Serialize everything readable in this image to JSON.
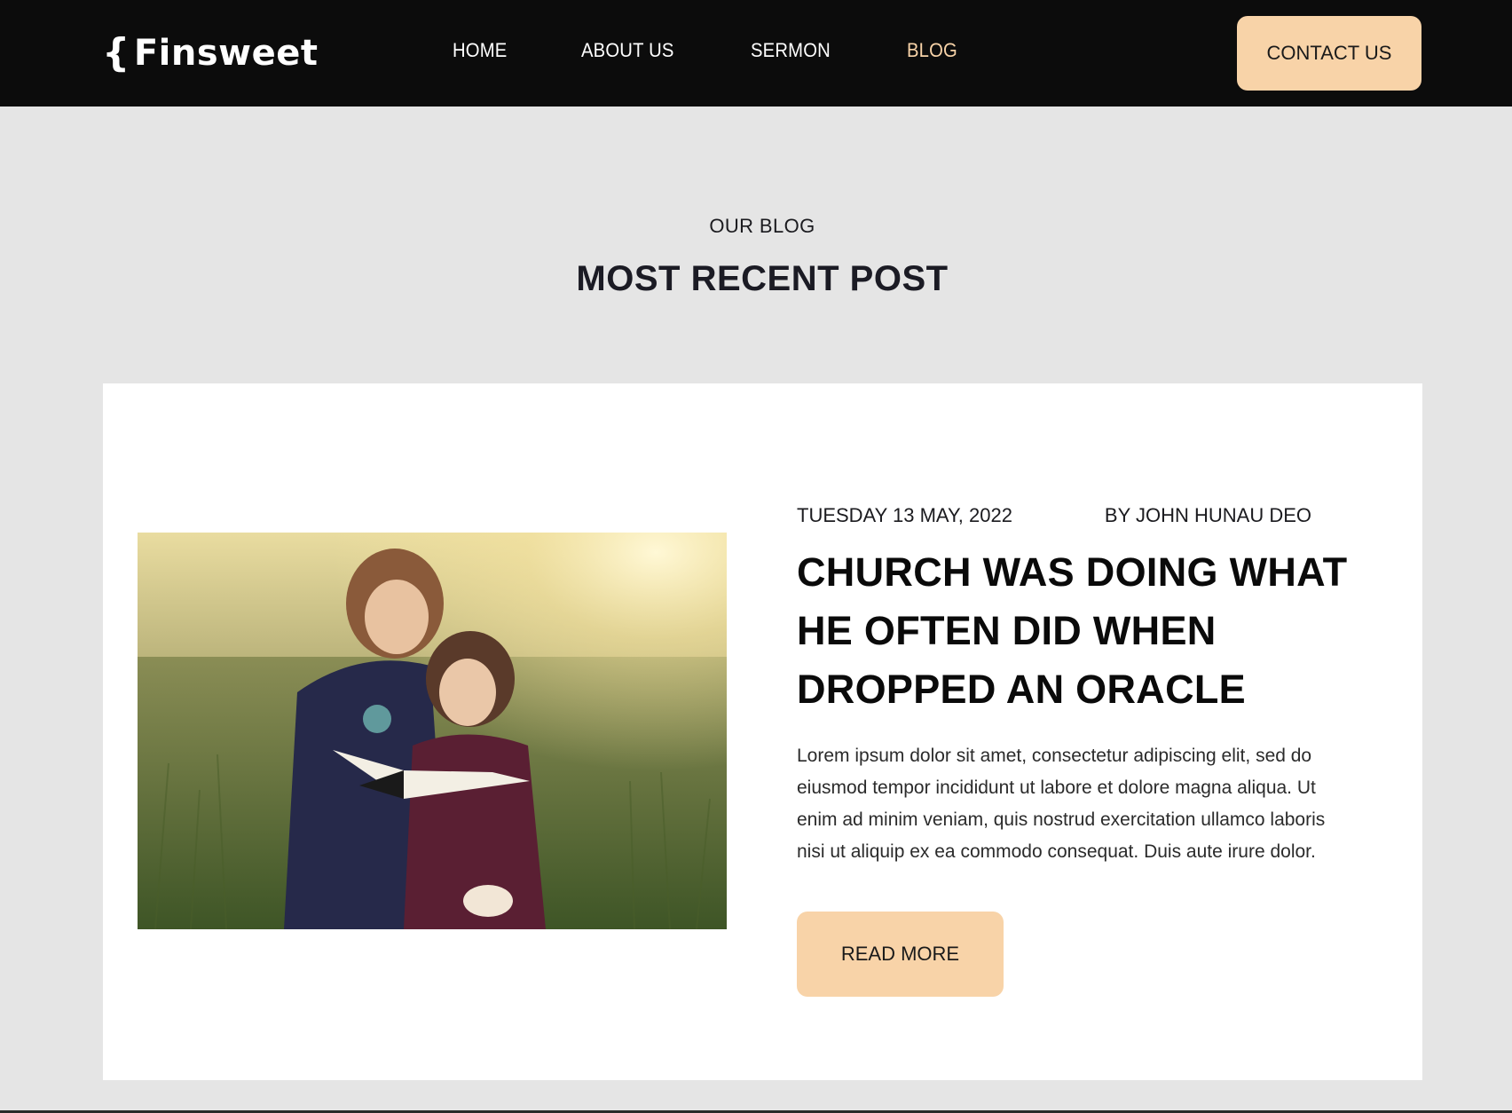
{
  "nav": {
    "logo_brace": "{",
    "logo_text": "Finsweet",
    "links": [
      {
        "label": "HOME"
      },
      {
        "label": "ABOUT US"
      },
      {
        "label": "SERMON"
      },
      {
        "label": "BLOG"
      }
    ],
    "active_link": "BLOG",
    "contact_label": "CONTACT US"
  },
  "section": {
    "eyebrow": "OUR BLOG",
    "title": "MOST RECENT POST"
  },
  "post": {
    "date": "TUESDAY 13 MAY, 2022",
    "author": "BY JOHN HUNAU DEO",
    "title": "CHURCH WAS DOING WHAT HE OFTEN DID WHEN DROPPED AN ORACLE",
    "excerpt": "Lorem ipsum dolor sit amet, consectetur adipiscing elit, sed do eiusmod tempor incididunt ut labore et dolore magna aliqua. Ut enim ad minim veniam, quis nostrud exercitation ullamco laboris nisi ut aliquip ex ea commodo consequat. Duis aute irure dolor.",
    "read_more_label": "READ MORE"
  },
  "colors": {
    "accent": "#f8d3a8",
    "nav_bg": "#0c0c0c",
    "page_bg": "#e5e5e5",
    "card_bg": "#ffffff"
  }
}
